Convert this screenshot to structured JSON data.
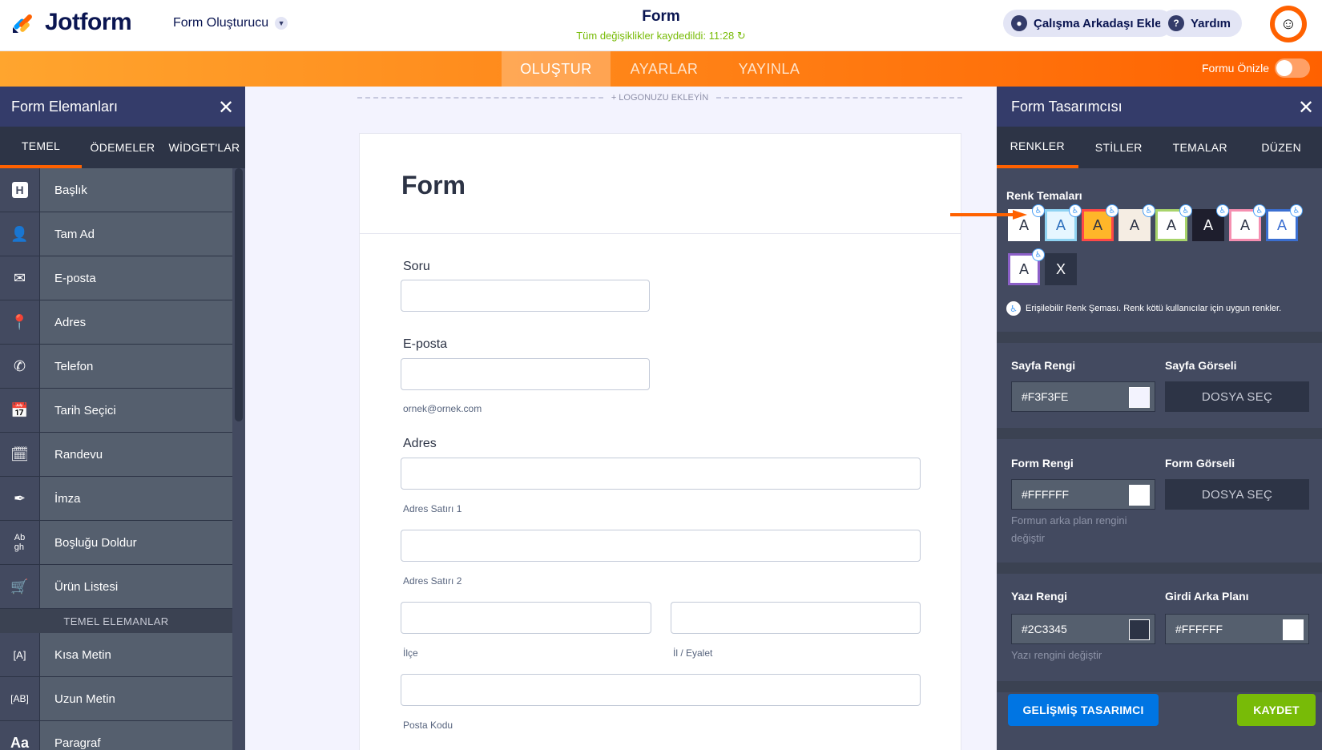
{
  "header": {
    "logo_text": "Jotform",
    "form_builder": "Form Oluşturucu",
    "form_title": "Form",
    "saved_status": "Tüm değişiklikler kaydedildi: 11:28",
    "add_collaborator": "Çalışma Arkadaşı Ekle",
    "help": "Yardım"
  },
  "nav": {
    "tabs": [
      "OLUŞTUR",
      "AYARLAR",
      "YAYINLA"
    ],
    "active_tab": "OLUŞTUR",
    "preview_label": "Formu Önizle",
    "preview_on": false
  },
  "left_panel": {
    "title": "Form Elemanları",
    "tabs": [
      "TEMEL",
      "ÖDEMELER",
      "WİDGET'LAR"
    ],
    "items": [
      {
        "label": "Başlık",
        "icon": "heading-icon"
      },
      {
        "label": "Tam Ad",
        "icon": "person-icon"
      },
      {
        "label": "E-posta",
        "icon": "envelope-icon"
      },
      {
        "label": "Adres",
        "icon": "map-pin-icon"
      },
      {
        "label": "Telefon",
        "icon": "phone-icon"
      },
      {
        "label": "Tarih Seçici",
        "icon": "calendar-icon"
      },
      {
        "label": "Randevu",
        "icon": "calendar-check-icon"
      },
      {
        "label": "İmza",
        "icon": "pen-icon"
      },
      {
        "label": "Boşluğu Doldur",
        "icon": "fill-blank-icon"
      },
      {
        "label": "Ürün Listesi",
        "icon": "cart-icon"
      }
    ],
    "section_label": "TEMEL ELEMANLAR",
    "basic_items": [
      {
        "label": "Kısa Metin",
        "icon": "short-text-icon"
      },
      {
        "label": "Uzun Metin",
        "icon": "long-text-icon"
      },
      {
        "label": "Paragraf",
        "icon": "paragraph-icon"
      }
    ]
  },
  "canvas": {
    "add_logo": "+ LOGONUZU EKLEYİN",
    "form_heading": "Form",
    "fields": {
      "q1_label": "Soru",
      "email_label": "E-posta",
      "email_hint": "ornek@ornek.com",
      "address_label": "Adres",
      "address_line1": "Adres Satırı 1",
      "address_line2": "Adres Satırı 2",
      "district": "İlçe",
      "province": "İl / Eyalet",
      "postal_code": "Posta Kodu"
    }
  },
  "right_panel": {
    "title": "Form Tasarımcısı",
    "tabs": [
      "RENKLER",
      "STİLLER",
      "TEMALAR",
      "DÜZEN"
    ],
    "active_tab": "RENKLER",
    "color_themes_title": "Renk Temaları",
    "themes": [
      {
        "letter": "A",
        "bg": "#ffffff",
        "border": "#ffffff",
        "text": "#2c3345",
        "accessible": true
      },
      {
        "letter": "A",
        "bg": "#e6f6ff",
        "border": "#8fd3f2",
        "text": "#2c6fbd",
        "accessible": true
      },
      {
        "letter": "A",
        "bg": "#ffb629",
        "border": "#ff4948",
        "text": "#2c3345",
        "accessible": true
      },
      {
        "letter": "A",
        "bg": "#f5ede3",
        "border": "#f5ede3",
        "text": "#2c3345",
        "accessible": true
      },
      {
        "letter": "A",
        "bg": "#ffffff",
        "border": "#a8d46b",
        "text": "#2c3345",
        "accessible": true
      },
      {
        "letter": "A",
        "bg": "#1e1e2d",
        "border": "#1e1e2d",
        "text": "#ffffff",
        "accessible": true
      },
      {
        "letter": "A",
        "bg": "#ffffff",
        "border": "#f58fb0",
        "text": "#2c3345",
        "accessible": true
      },
      {
        "letter": "A",
        "bg": "#ffffff",
        "border": "#3b6fd1",
        "text": "#3b6fd1",
        "accessible": true
      },
      {
        "letter": "A",
        "bg": "#ffffff",
        "border": "#8c60c8",
        "text": "#2c3345",
        "accessible": true
      },
      {
        "letter": "X",
        "bg": "#2d3446",
        "border": "#2d3446",
        "text": "#ffffff",
        "accessible": false
      }
    ],
    "accessible_note": "Erişilebilir Renk Şeması. Renk kötü kullanıcılar için uygun renkler.",
    "page_color_label": "Sayfa Rengi",
    "page_color_value": "#F3F3FE",
    "page_image_label": "Sayfa Görseli",
    "choose_file": "DOSYA SEÇ",
    "form_color_label": "Form Rengi",
    "form_color_value": "#FFFFFF",
    "form_color_hint": "Formun arka plan rengini değiştir",
    "form_image_label": "Form Görseli",
    "text_color_label": "Yazı Rengi",
    "text_color_value": "#2C3345",
    "text_color_hint": "Yazı rengini değiştir",
    "input_bg_label": "Girdi Arka Planı",
    "input_bg_value": "#FFFFFF",
    "advanced_designer": "GELİŞMİŞ TASARIMCI",
    "save": "KAYDET"
  },
  "colors": {
    "accent_orange": "#ff6100",
    "save_green": "#78bb07",
    "advanced_blue": "#0075e3",
    "panel_dark": "#434a60"
  }
}
